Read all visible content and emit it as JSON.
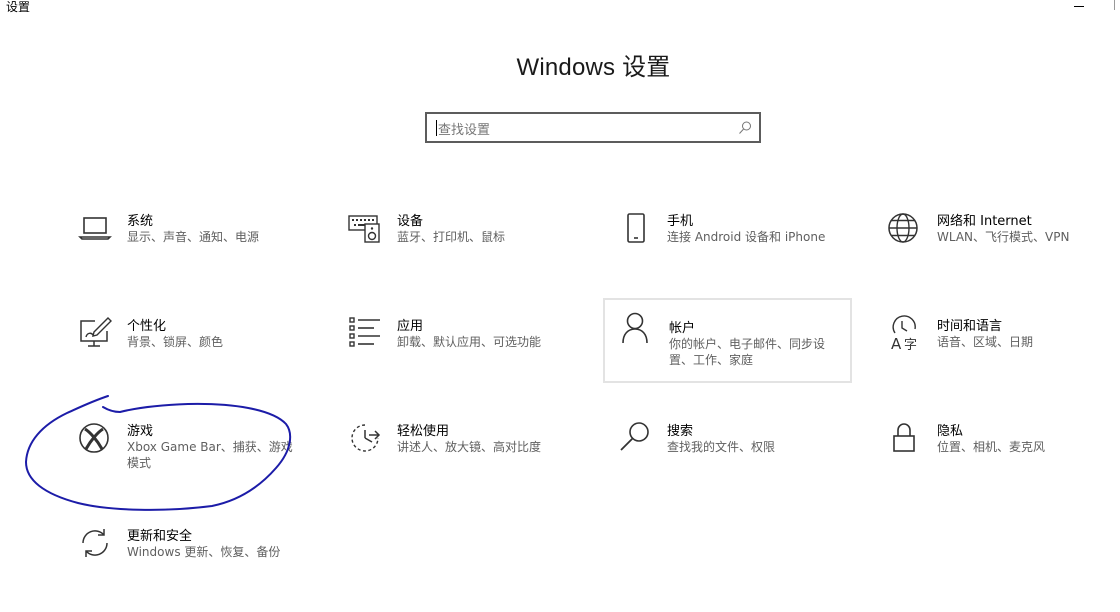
{
  "window": {
    "title": "设置"
  },
  "page": {
    "title": "Windows 设置"
  },
  "search": {
    "placeholder": "查找设置"
  },
  "tiles": [
    {
      "title": "系统",
      "desc": "显示、声音、通知、电源",
      "icon": "laptop-icon"
    },
    {
      "title": "设备",
      "desc": "蓝牙、打印机、鼠标",
      "icon": "keyboard-speaker-icon"
    },
    {
      "title": "手机",
      "desc": "连接 Android 设备和 iPhone",
      "icon": "phone-icon"
    },
    {
      "title": "网络和 Internet",
      "desc": "WLAN、飞行模式、VPN",
      "icon": "globe-icon"
    },
    {
      "title": "个性化",
      "desc": "背景、锁屏、颜色",
      "icon": "paint-monitor-icon"
    },
    {
      "title": "应用",
      "desc": "卸载、默认应用、可选功能",
      "icon": "app-list-icon"
    },
    {
      "title": "帐户",
      "desc": "你的帐户、电子邮件、同步设置、工作、家庭",
      "icon": "person-icon"
    },
    {
      "title": "时间和语言",
      "desc": "语音、区域、日期",
      "icon": "time-language-icon"
    },
    {
      "title": "游戏",
      "desc": "Xbox Game Bar、捕获、游戏模式",
      "icon": "xbox-icon"
    },
    {
      "title": "轻松使用",
      "desc": "讲述人、放大镜、高对比度",
      "icon": "ease-of-access-icon"
    },
    {
      "title": "搜索",
      "desc": "查找我的文件、权限",
      "icon": "search-magnifier-icon"
    },
    {
      "title": "隐私",
      "desc": "位置、相机、麦克风",
      "icon": "lock-icon"
    },
    {
      "title": "更新和安全",
      "desc": "Windows 更新、恢复、备份",
      "icon": "sync-arrows-icon"
    }
  ]
}
